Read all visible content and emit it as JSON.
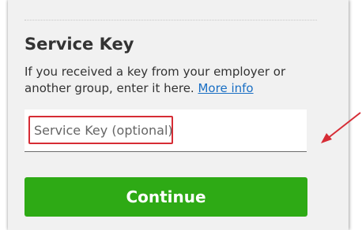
{
  "section": {
    "title": "Service Key",
    "description": "If you received a key from your employer or another group, enter it here.",
    "more_info_link": "More info"
  },
  "service_key_input": {
    "placeholder": "Service Key (optional)",
    "value": ""
  },
  "continue_button": {
    "label": "Continue"
  },
  "annotation": {
    "highlight_color": "#d62c35",
    "arrow_icon": "red-pointer-arrow"
  },
  "colors": {
    "button_green": "#2eaa15",
    "link_blue": "#1a6fc4",
    "card_background": "#f1f1f1"
  }
}
